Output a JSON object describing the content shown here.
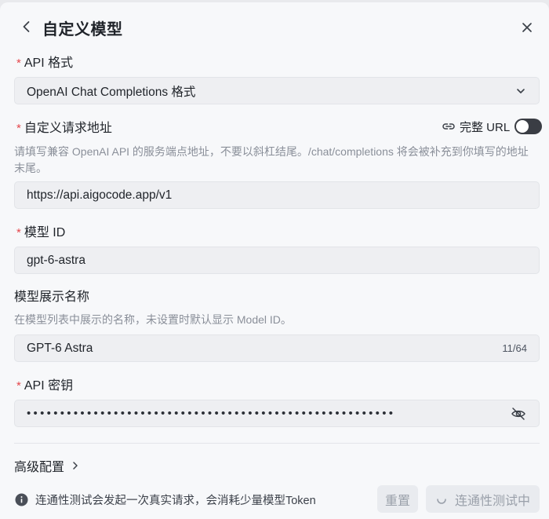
{
  "dialog": {
    "title": "自定义模型"
  },
  "api_format": {
    "required_mark": "*",
    "label": "API 格式",
    "selected": "OpenAI Chat Completions 格式"
  },
  "endpoint": {
    "required_mark": "*",
    "label": "自定义请求地址",
    "full_url_label": "完整 URL",
    "full_url_enabled": false,
    "hint": "请填写兼容 OpenAI API 的服务端点地址，不要以斜杠结尾。/chat/completions 将会被补充到你填写的地址末尾。",
    "value": "https://api.aigocode.app/v1"
  },
  "model_id": {
    "required_mark": "*",
    "label": "模型 ID",
    "value": "gpt-6-astra"
  },
  "display_name": {
    "label": "模型展示名称",
    "hint": "在模型列表中展示的名称，未设置时默认显示 Model ID。",
    "value": "GPT-6 Astra",
    "counter": "11/64"
  },
  "api_key": {
    "required_mark": "*",
    "label": "API 密钥",
    "masked_value": "•••••••••••••••••••••••••••••••••••••••••••••••••••••••"
  },
  "advanced": {
    "label": "高级配置"
  },
  "footer": {
    "note": "连通性测试会发起一次真实请求，会消耗少量模型Token",
    "reset_label": "重置",
    "test_label": "连通性测试中"
  },
  "icons": {
    "back": "chevron-left-icon",
    "close": "close-icon",
    "select": "chevron-down-icon",
    "link": "link-icon",
    "eye": "eye-off-icon",
    "advanced": "chevron-right-icon",
    "info": "info-icon",
    "spinner": "spinner-icon"
  },
  "colors": {
    "required": "#e5484d",
    "toggle_off": "#3a3d44",
    "background": "#f7f8fa",
    "field_bg": "#eeeff2"
  }
}
